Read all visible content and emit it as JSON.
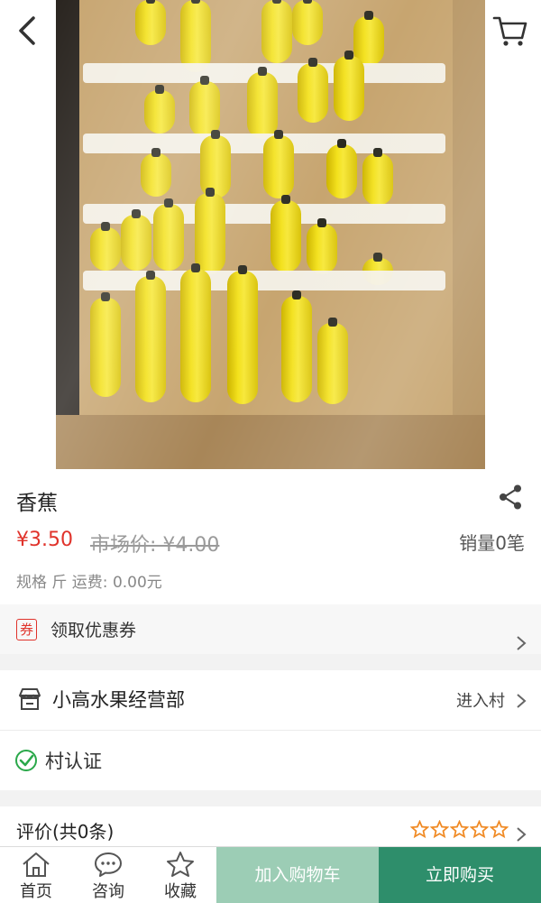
{
  "product": {
    "name": "香蕉",
    "price": "¥3.50",
    "market_price": "市场价: ¥4.00",
    "sales": "销量0笔",
    "spec_freight": "规格 斤 运费: 0.00元"
  },
  "coupon": {
    "tag": "券",
    "label": "领取优惠券"
  },
  "shop": {
    "name": "小高水果经营部",
    "enter_label": "进入村",
    "verified_label": "村认证"
  },
  "reviews": {
    "label": "评价(共0条)",
    "rating_stars": 0,
    "max_stars": 5
  },
  "bottom_nav": {
    "home": "首页",
    "consult": "咨询",
    "favorite": "收藏",
    "add_to_cart": "加入购物车",
    "buy_now": "立即购买"
  },
  "colors": {
    "price_red": "#e0332b",
    "accent_green": "#2e8e6b",
    "light_green": "#9ccdb5",
    "star_orange": "#f08a24"
  },
  "icons": {
    "back": "chevron-left-icon",
    "cart": "shopping-cart-icon",
    "share": "share-icon",
    "shop": "shop-icon",
    "verified": "check-circle-icon",
    "home": "home-icon",
    "consult": "chat-icon",
    "favorite": "star-icon"
  }
}
